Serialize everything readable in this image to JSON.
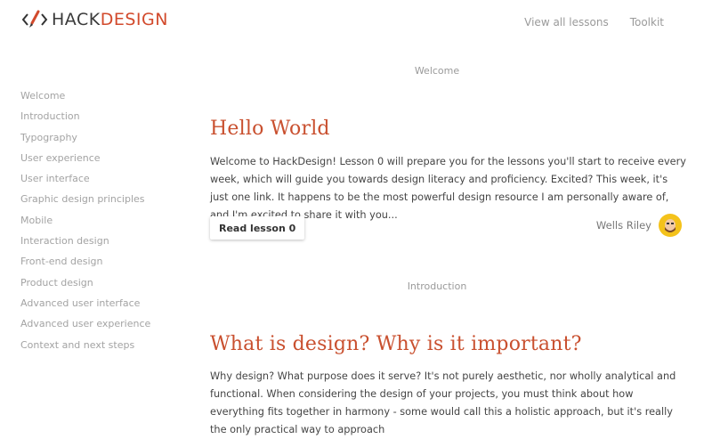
{
  "header": {
    "logo_hack": "HACK",
    "logo_design": "DESIGN",
    "nav": [
      "View all lessons",
      "Toolkit"
    ]
  },
  "sidebar": {
    "items": [
      "Welcome",
      "Introduction",
      "Typography",
      "User experience",
      "User interface",
      "Graphic design principles",
      "Mobile",
      "Interaction design",
      "Front-end design",
      "Product design",
      "Advanced user interface",
      "Advanced user experience",
      "Context and next steps"
    ]
  },
  "lessons": [
    {
      "section": "Welcome",
      "title": "Hello World",
      "body": "Welcome to HackDesign! Lesson 0 will prepare you for the lessons you'll start to receive every week, which will guide you towards design literacy and proficiency. Excited? This week, it's just one link. It happens to be the most powerful design resource I am personally aware of, and I'm excited to share it with you...",
      "button": "Read lesson 0",
      "author": "Wells Riley"
    },
    {
      "section": "Introduction",
      "title": "What is design? Why is it important?",
      "body": "Why design? What purpose does it serve? It's not purely aesthetic, nor wholly analytical and functional. When considering the design of your projects, you must think about how everything fits together in harmony - some would call this a holistic approach, but it's really the only practical way to approach"
    }
  ],
  "colors": {
    "accent": "#c9502f",
    "muted": "#a3a3a3",
    "avatar_bg": "#f4c21b"
  }
}
